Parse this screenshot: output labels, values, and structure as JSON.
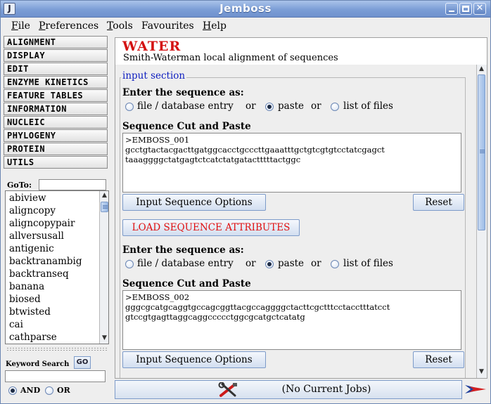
{
  "window": {
    "title": "Jemboss",
    "icon_label": "J"
  },
  "menu": [
    {
      "key": "F",
      "rest": "ile"
    },
    {
      "key": "P",
      "rest": "references"
    },
    {
      "key": "T",
      "rest": "ools"
    },
    {
      "key": "",
      "rest": "Favourites"
    },
    {
      "key": "H",
      "rest": "elp"
    }
  ],
  "categories": [
    "ALIGNMENT",
    "DISPLAY",
    "EDIT",
    "ENZYME KINETICS",
    "FEATURE TABLES",
    "INFORMATION",
    "NUCLEIC",
    "PHYLOGENY",
    "PROTEIN",
    "UTILS"
  ],
  "goto": {
    "label": "GoTo:",
    "value": ""
  },
  "programs": [
    "abiview",
    "aligncopy",
    "aligncopypair",
    "allversusall",
    "antigenic",
    "backtranambig",
    "backtranseq",
    "banana",
    "biosed",
    "btwisted",
    "cai",
    "cathparse"
  ],
  "keyword": {
    "label": "Keyword Search",
    "go_label": "GO",
    "value": "",
    "and_label": "AND",
    "or_label": "OR",
    "selected": "AND"
  },
  "program": {
    "name": "WATER",
    "description": "Smith-Waterman local alignment of sequences"
  },
  "input_section": {
    "title": "input section",
    "sequences": [
      {
        "enter_as_label": "Enter the sequence as:",
        "opt_file": "file / database entry",
        "or1": "or",
        "opt_paste": "paste",
        "or2": "or",
        "opt_list": "list of files",
        "selected": "paste",
        "paste_label": "Sequence Cut and Paste",
        "text": ">EMBOSS_001\ngcctgtactacgacttgatggcacctgcccttgaaatttgctgtcgtgtcctatcgagct\ntaaaggggctatgagtctcatctatgatactttttactggc",
        "options_button": "Input Sequence Options",
        "reset_button": "Reset"
      },
      {
        "enter_as_label": "Enter the sequence as:",
        "opt_file": "file / database entry",
        "or1": "or",
        "opt_paste": "paste",
        "or2": "or",
        "opt_list": "list of files",
        "selected": "paste",
        "paste_label": "Sequence Cut and Paste",
        "text": ">EMBOSS_002\ngggcgcatgcaggtgccagcggttacgccaggggctacttcgctttcctacctttatcct\ngtccgtgagttaggcaggccccctggcgcatgctcatatg",
        "options_button": "Input Sequence Options",
        "reset_button": "Reset"
      }
    ],
    "load_attributes_button": "LOAD SEQUENCE ATTRIBUTES"
  },
  "status": {
    "jobs_text": "(No Current Jobs)"
  },
  "colors": {
    "title_red": "#d41010",
    "section_blue": "#1020c0",
    "titlebar": "#7b9dd6"
  }
}
